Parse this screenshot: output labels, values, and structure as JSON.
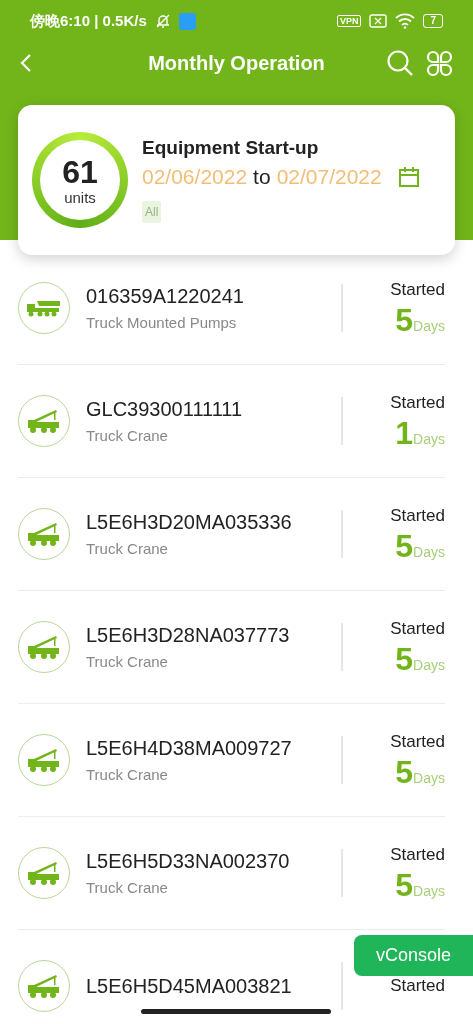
{
  "status_bar": {
    "time": "傍晚6:10 | 0.5K/s",
    "vpn": "VPN",
    "battery": "7"
  },
  "header": {
    "title": "Monthly Operation"
  },
  "summary": {
    "count": "61",
    "unit": "units",
    "title": "Equipment Start-up",
    "date_from": "02/06/2022",
    "to": "to",
    "date_to": "02/07/2022",
    "tag": "All"
  },
  "equipment": [
    {
      "id": "016359A1220241",
      "type": "Truck Mounted Pumps",
      "kind": "pump",
      "status": "Started",
      "days": "5",
      "unit": "Days"
    },
    {
      "id": "GLC39300111111",
      "type": "Truck Crane",
      "kind": "crane",
      "status": "Started",
      "days": "1",
      "unit": "Days"
    },
    {
      "id": "L5E6H3D20MA035336",
      "type": "Truck Crane",
      "kind": "crane",
      "status": "Started",
      "days": "5",
      "unit": "Days"
    },
    {
      "id": "L5E6H3D28NA037773",
      "type": "Truck Crane",
      "kind": "crane",
      "status": "Started",
      "days": "5",
      "unit": "Days"
    },
    {
      "id": "L5E6H4D38MA009727",
      "type": "Truck Crane",
      "kind": "crane",
      "status": "Started",
      "days": "5",
      "unit": "Days"
    },
    {
      "id": "L5E6H5D33NA002370",
      "type": "Truck Crane",
      "kind": "crane",
      "status": "Started",
      "days": "5",
      "unit": "Days"
    },
    {
      "id": "L5E6H5D45MA003821",
      "kind": "crane",
      "status": "Started"
    }
  ],
  "floating_button": "vConsole"
}
